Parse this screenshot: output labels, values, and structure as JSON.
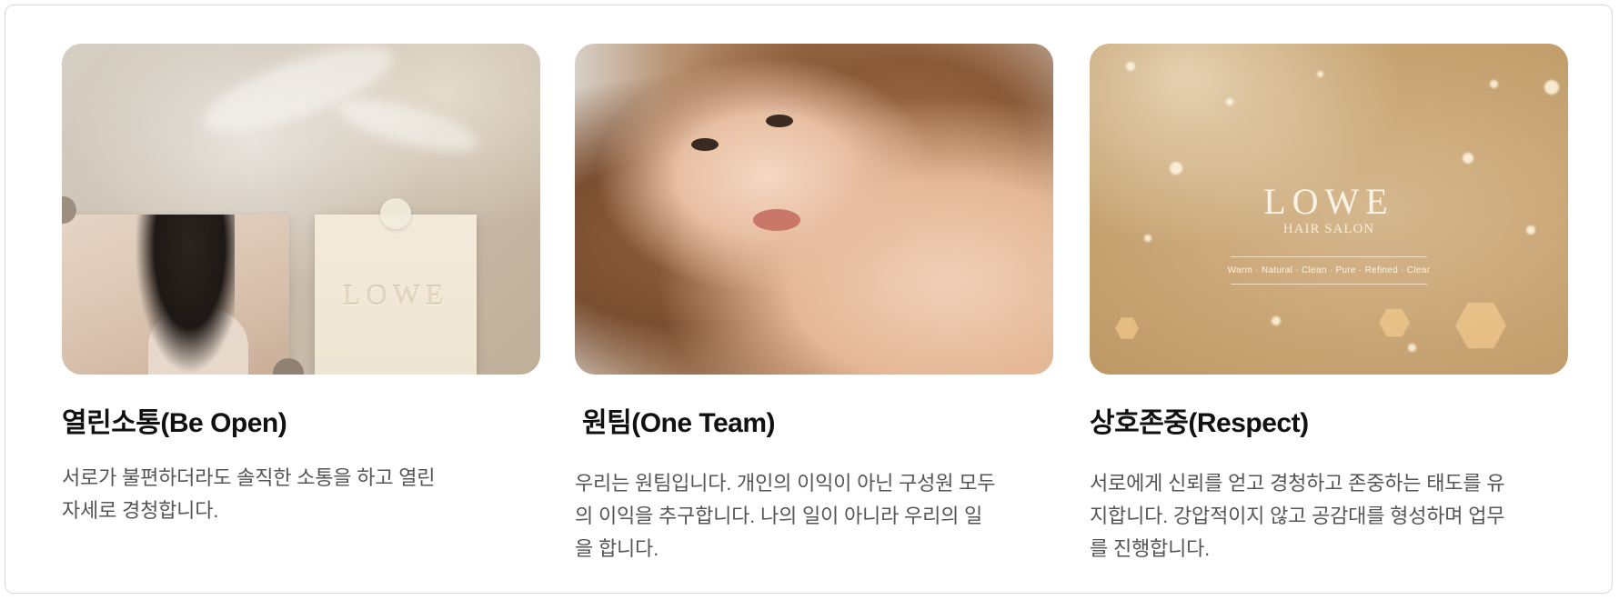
{
  "cards": [
    {
      "title": "열린소통(Be Open)",
      "description": "서로가 불편하더라도 솔직한 소통을 하고 열린\n자세로 경청합니다.",
      "image": {
        "logo_text": "LOWE"
      }
    },
    {
      "title": "원팀(One Team)",
      "description": "우리는 원팀입니다. 개인의 이익이 아닌 구성원 모두\n의 이익을 추구합니다.  나의 일이 아니라 우리의 일\n을 합니다."
    },
    {
      "title": "상호존중(Respect)",
      "description": "서로에게 신뢰를 얻고 경청하고 존중하는 태도를 유\n지합니다. 강압적이지 않고 공감대를 형성하며 업무\n를 진행합니다.",
      "image": {
        "brand": "LOWE",
        "subtitle": "HAIR SALON",
        "tagline": "Warm · Natural · Clean · Pure · Refined · Clear"
      }
    }
  ]
}
